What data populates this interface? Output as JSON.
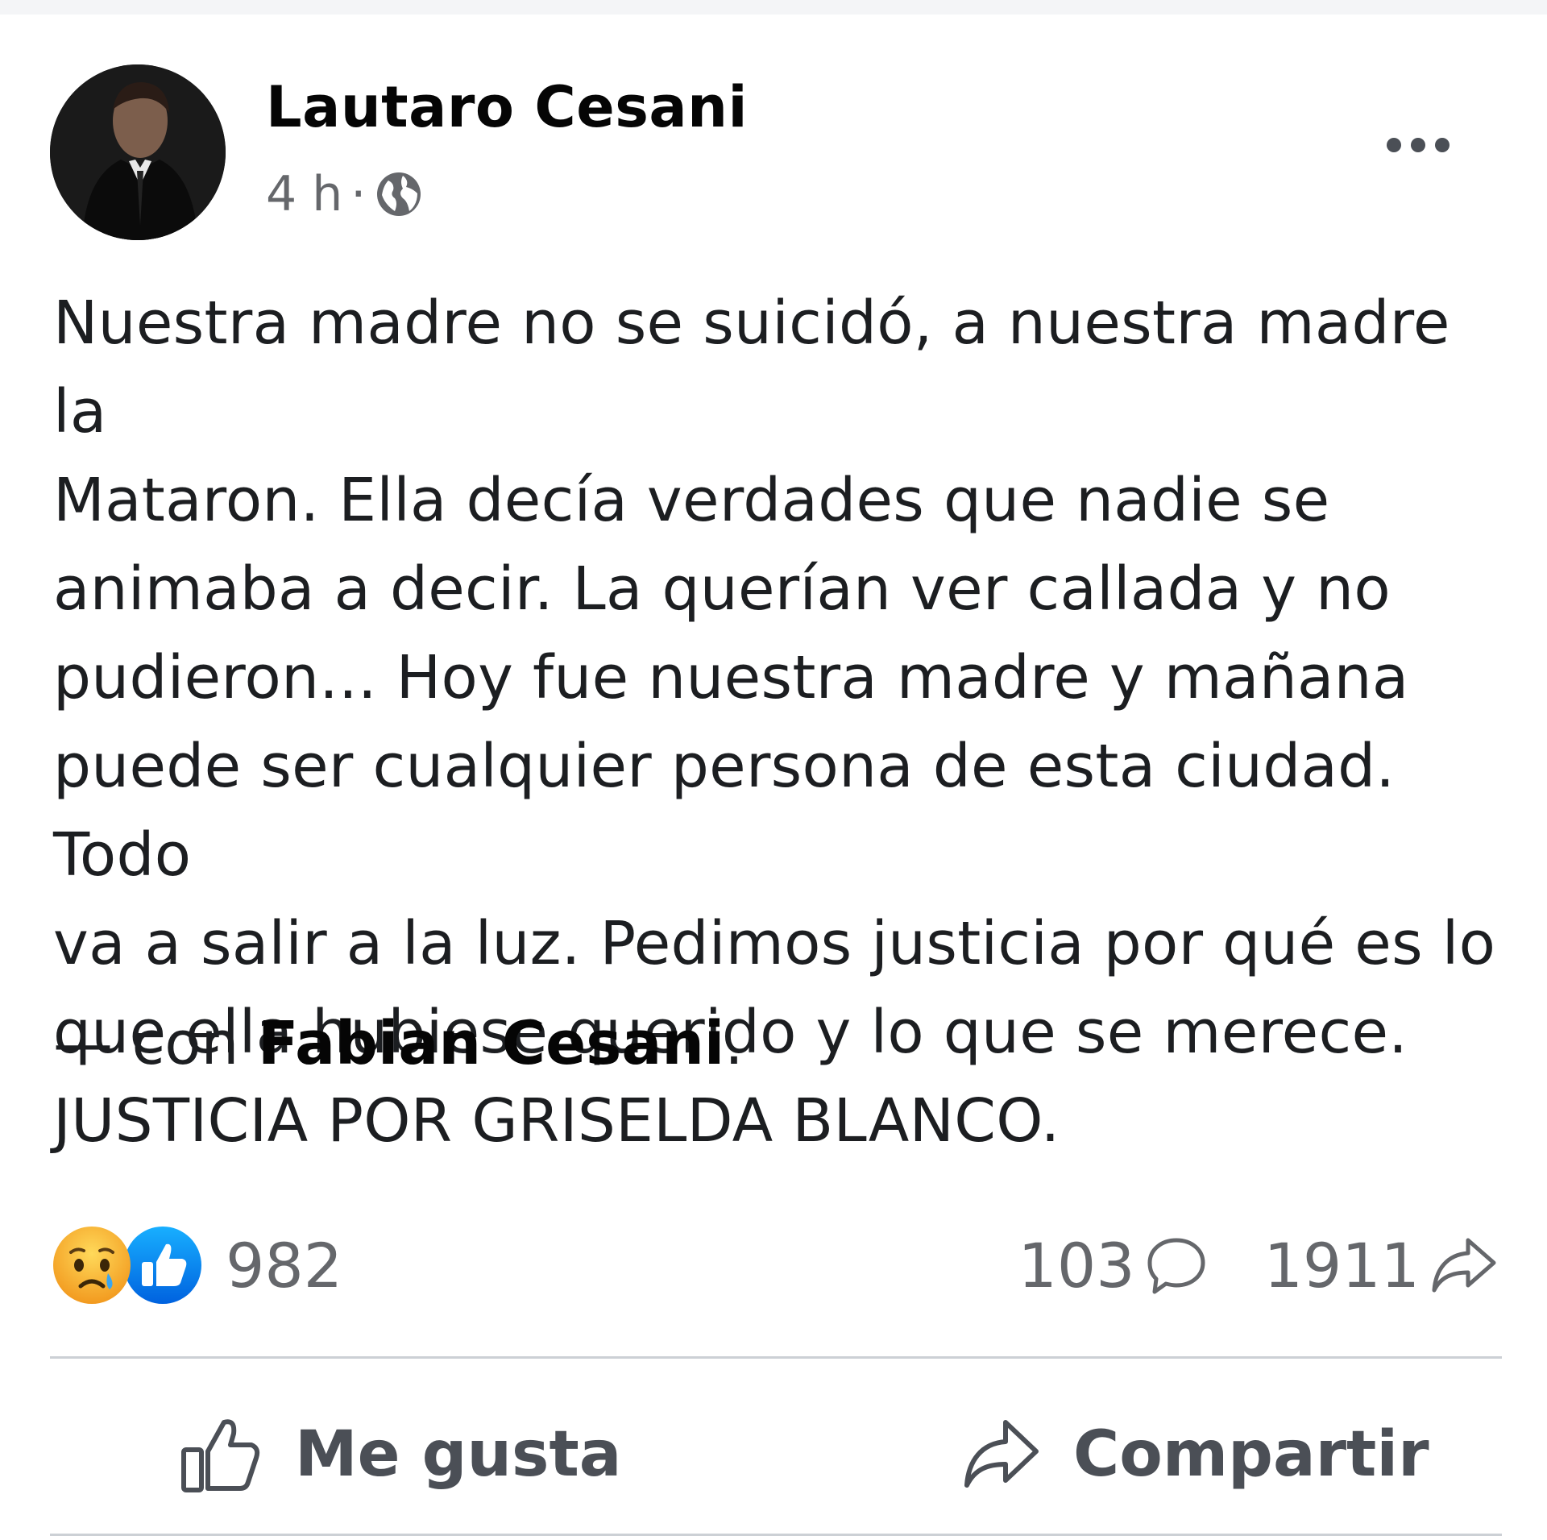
{
  "post": {
    "author": "Lautaro Cesani",
    "time": "4 h",
    "separator": "·",
    "privacy_icon": "globe-icon",
    "body": "Nuestra madre no se suicidó, a nuestra madre la\nMataron. Ella decía verdades que nadie se\nanimaba a decir. La querían ver callada y no\npudieron... Hoy fue nuestra madre y mañana\npuede ser cualquier persona de esta ciudad. Todo\nva a salir a la luz. Pedimos justicia por qué es lo\nque ella hubiese querido y lo que se merece.\nJUSTICIA POR GRISELDA BLANCO.",
    "with_prefix": "— con ",
    "with_name": "Fabian Cesani",
    "with_suffix": "."
  },
  "stats": {
    "reactions_count": "982",
    "reaction_icons": [
      "sad-reaction-icon",
      "like-reaction-icon"
    ],
    "comments_count": "103",
    "shares_count": "1911"
  },
  "actions": {
    "like_label": "Me gusta",
    "share_label": "Compartir"
  },
  "colors": {
    "text": "#050505",
    "secondary_text": "#65676b",
    "like_blue": "#1877f2",
    "sad_yellow": "#f7b125",
    "divider": "#ccd0d5"
  }
}
